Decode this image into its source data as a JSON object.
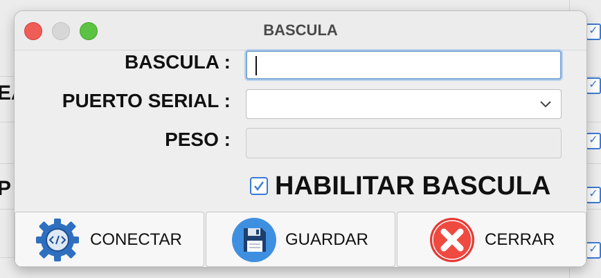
{
  "background": {
    "fragments": [
      "EA",
      "P"
    ]
  },
  "dialog": {
    "title": "BASCULA",
    "fields": {
      "bascula_label": "BASCULA :",
      "bascula_value": "",
      "puerto_label": "PUERTO SERIAL :",
      "puerto_selected": "",
      "peso_label": "PESO :",
      "peso_value": ""
    },
    "checkbox": {
      "label": "HABILITAR BASCULA",
      "checked": true
    },
    "buttons": {
      "connect": "CONECTAR",
      "save": "GUARDAR",
      "close": "CERRAR"
    }
  },
  "colors": {
    "accent": "#3a7bd5",
    "close_red": "#e53935",
    "save_blue": "#2f80d1",
    "gear_blue": "#2f6fc0"
  },
  "icons": {
    "connect": "gear-code-icon",
    "save": "floppy-disk-icon",
    "close": "red-x-icon"
  }
}
